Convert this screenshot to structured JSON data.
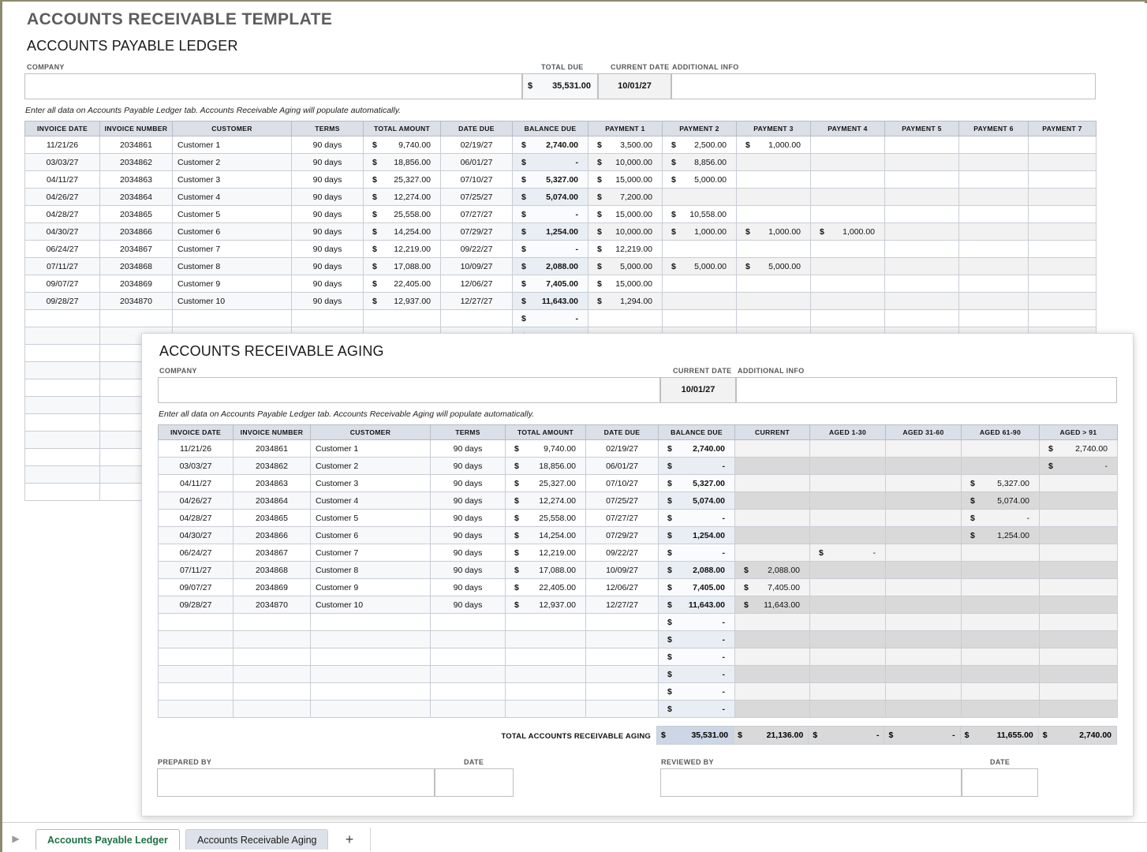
{
  "doc": {
    "title": "ACCOUNTS RECEIVABLE TEMPLATE",
    "section_title": "ACCOUNTS PAYABLE LEDGER",
    "note": "Enter all data on Accounts Payable Ledger tab.  Accounts Receivable Aging will populate automatically."
  },
  "ledger_header": {
    "company_label": "COMPANY",
    "company_value": "",
    "total_due_label": "TOTAL DUE",
    "total_due_symbol": "$",
    "total_due_value": "35,531.00",
    "current_date_label": "CURRENT DATE",
    "current_date_value": "10/01/27",
    "additional_info_label": "ADDITIONAL INFO",
    "additional_info_value": ""
  },
  "ledger_table": {
    "columns": [
      "INVOICE DATE",
      "INVOICE NUMBER",
      "CUSTOMER",
      "TERMS",
      "TOTAL AMOUNT",
      "DATE DUE",
      "BALANCE DUE",
      "PAYMENT 1",
      "PAYMENT 2",
      "PAYMENT 3",
      "PAYMENT 4",
      "PAYMENT 5",
      "PAYMENT 6",
      "PAYMENT 7"
    ],
    "currency_symbol": "$",
    "rows": [
      {
        "invoice_date": "11/21/26",
        "invoice_number": "2034861",
        "customer": "Customer 1",
        "terms": "90 days",
        "total_amount": "9,740.00",
        "date_due": "02/19/27",
        "balance_due": "2,740.00",
        "payments": [
          "3,500.00",
          "2,500.00",
          "1,000.00",
          "",
          "",
          "",
          ""
        ]
      },
      {
        "invoice_date": "03/03/27",
        "invoice_number": "2034862",
        "customer": "Customer 2",
        "terms": "90 days",
        "total_amount": "18,856.00",
        "date_due": "06/01/27",
        "balance_due": "-",
        "payments": [
          "10,000.00",
          "8,856.00",
          "",
          "",
          "",
          "",
          ""
        ]
      },
      {
        "invoice_date": "04/11/27",
        "invoice_number": "2034863",
        "customer": "Customer 3",
        "terms": "90 days",
        "total_amount": "25,327.00",
        "date_due": "07/10/27",
        "balance_due": "5,327.00",
        "payments": [
          "15,000.00",
          "5,000.00",
          "",
          "",
          "",
          "",
          ""
        ]
      },
      {
        "invoice_date": "04/26/27",
        "invoice_number": "2034864",
        "customer": "Customer 4",
        "terms": "90 days",
        "total_amount": "12,274.00",
        "date_due": "07/25/27",
        "balance_due": "5,074.00",
        "payments": [
          "7,200.00",
          "",
          "",
          "",
          "",
          "",
          ""
        ]
      },
      {
        "invoice_date": "04/28/27",
        "invoice_number": "2034865",
        "customer": "Customer 5",
        "terms": "90 days",
        "total_amount": "25,558.00",
        "date_due": "07/27/27",
        "balance_due": "-",
        "payments": [
          "15,000.00",
          "10,558.00",
          "",
          "",
          "",
          "",
          ""
        ]
      },
      {
        "invoice_date": "04/30/27",
        "invoice_number": "2034866",
        "customer": "Customer 6",
        "terms": "90 days",
        "total_amount": "14,254.00",
        "date_due": "07/29/27",
        "balance_due": "1,254.00",
        "payments": [
          "10,000.00",
          "1,000.00",
          "1,000.00",
          "1,000.00",
          "",
          "",
          ""
        ]
      },
      {
        "invoice_date": "06/24/27",
        "invoice_number": "2034867",
        "customer": "Customer 7",
        "terms": "90 days",
        "total_amount": "12,219.00",
        "date_due": "09/22/27",
        "balance_due": "-",
        "payments": [
          "12,219.00",
          "",
          "",
          "",
          "",
          "",
          ""
        ]
      },
      {
        "invoice_date": "07/11/27",
        "invoice_number": "2034868",
        "customer": "Customer 8",
        "terms": "90 days",
        "total_amount": "17,088.00",
        "date_due": "10/09/27",
        "balance_due": "2,088.00",
        "payments": [
          "5,000.00",
          "5,000.00",
          "5,000.00",
          "",
          "",
          "",
          ""
        ]
      },
      {
        "invoice_date": "09/07/27",
        "invoice_number": "2034869",
        "customer": "Customer 9",
        "terms": "90 days",
        "total_amount": "22,405.00",
        "date_due": "12/06/27",
        "balance_due": "7,405.00",
        "payments": [
          "15,000.00",
          "",
          "",
          "",
          "",
          "",
          ""
        ]
      },
      {
        "invoice_date": "09/28/27",
        "invoice_number": "2034870",
        "customer": "Customer 10",
        "terms": "90 days",
        "total_amount": "12,937.00",
        "date_due": "12/27/27",
        "balance_due": "11,643.00",
        "payments": [
          "1,294.00",
          "",
          "",
          "",
          "",
          "",
          ""
        ]
      },
      {
        "invoice_date": "",
        "invoice_number": "",
        "customer": "",
        "terms": "",
        "total_amount": "",
        "date_due": "",
        "balance_due": "-",
        "payments": [
          "",
          "",
          "",
          "",
          "",
          "",
          ""
        ]
      },
      {
        "invoice_date": "",
        "invoice_number": "",
        "customer": "",
        "terms": "",
        "total_amount": "",
        "date_due": "",
        "balance_due": "-",
        "payments": [
          "",
          "",
          "",
          "",
          "",
          "",
          ""
        ]
      },
      {
        "invoice_date": "",
        "invoice_number": "",
        "customer": "",
        "terms": "",
        "total_amount": "",
        "date_due": "",
        "balance_due": "",
        "payments": [
          "",
          "",
          "",
          "",
          "",
          "",
          ""
        ]
      },
      {
        "invoice_date": "",
        "invoice_number": "",
        "customer": "",
        "terms": "",
        "total_amount": "",
        "date_due": "",
        "balance_due": "",
        "payments": [
          "",
          "",
          "",
          "",
          "",
          "",
          ""
        ]
      },
      {
        "invoice_date": "",
        "invoice_number": "",
        "customer": "",
        "terms": "",
        "total_amount": "",
        "date_due": "",
        "balance_due": "",
        "payments": [
          "",
          "",
          "",
          "",
          "",
          "",
          ""
        ]
      },
      {
        "invoice_date": "",
        "invoice_number": "",
        "customer": "",
        "terms": "",
        "total_amount": "",
        "date_due": "",
        "balance_due": "",
        "payments": [
          "",
          "",
          "",
          "",
          "",
          "",
          ""
        ]
      },
      {
        "invoice_date": "",
        "invoice_number": "",
        "customer": "",
        "terms": "",
        "total_amount": "",
        "date_due": "",
        "balance_due": "",
        "payments": [
          "",
          "",
          "",
          "",
          "",
          "",
          ""
        ]
      },
      {
        "invoice_date": "",
        "invoice_number": "",
        "customer": "",
        "terms": "",
        "total_amount": "",
        "date_due": "",
        "balance_due": "",
        "payments": [
          "",
          "",
          "",
          "",
          "",
          "",
          ""
        ]
      },
      {
        "invoice_date": "",
        "invoice_number": "",
        "customer": "",
        "terms": "",
        "total_amount": "",
        "date_due": "",
        "balance_due": "",
        "payments": [
          "",
          "",
          "",
          "",
          "",
          "",
          ""
        ]
      },
      {
        "invoice_date": "",
        "invoice_number": "",
        "customer": "",
        "terms": "",
        "total_amount": "",
        "date_due": "",
        "balance_due": "",
        "payments": [
          "",
          "",
          "",
          "",
          "",
          "",
          ""
        ]
      },
      {
        "invoice_date": "",
        "invoice_number": "",
        "customer": "",
        "terms": "",
        "total_amount": "",
        "date_due": "",
        "balance_due": "",
        "payments": [
          "",
          "",
          "",
          "",
          "",
          "",
          ""
        ]
      }
    ]
  },
  "ar_panel": {
    "title": "ACCOUNTS RECEIVABLE AGING",
    "note": "Enter all data on Accounts Payable Ledger tab.  Accounts Receivable Aging will populate automatically.",
    "company_label": "COMPANY",
    "company_value": "",
    "current_date_label": "CURRENT DATE",
    "current_date_value": "10/01/27",
    "additional_info_label": "ADDITIONAL INFO",
    "additional_info_value": "",
    "columns": [
      "INVOICE DATE",
      "INVOICE NUMBER",
      "CUSTOMER",
      "TERMS",
      "TOTAL AMOUNT",
      "DATE DUE",
      "BALANCE DUE",
      "CURRENT",
      "AGED 1-30",
      "AGED 31-60",
      "AGED 61-90",
      "AGED > 91"
    ],
    "currency_symbol": "$",
    "rows": [
      {
        "invoice_date": "11/21/26",
        "invoice_number": "2034861",
        "customer": "Customer 1",
        "terms": "90 days",
        "total_amount": "9,740.00",
        "date_due": "02/19/27",
        "balance_due": "2,740.00",
        "current": "",
        "aged_1_30": "",
        "aged_31_60": "",
        "aged_61_90": "",
        "aged_91": "2,740.00"
      },
      {
        "invoice_date": "03/03/27",
        "invoice_number": "2034862",
        "customer": "Customer 2",
        "terms": "90 days",
        "total_amount": "18,856.00",
        "date_due": "06/01/27",
        "balance_due": "-",
        "current": "",
        "aged_1_30": "",
        "aged_31_60": "",
        "aged_61_90": "",
        "aged_91": "-"
      },
      {
        "invoice_date": "04/11/27",
        "invoice_number": "2034863",
        "customer": "Customer 3",
        "terms": "90 days",
        "total_amount": "25,327.00",
        "date_due": "07/10/27",
        "balance_due": "5,327.00",
        "current": "",
        "aged_1_30": "",
        "aged_31_60": "",
        "aged_61_90": "5,327.00",
        "aged_91": ""
      },
      {
        "invoice_date": "04/26/27",
        "invoice_number": "2034864",
        "customer": "Customer 4",
        "terms": "90 days",
        "total_amount": "12,274.00",
        "date_due": "07/25/27",
        "balance_due": "5,074.00",
        "current": "",
        "aged_1_30": "",
        "aged_31_60": "",
        "aged_61_90": "5,074.00",
        "aged_91": ""
      },
      {
        "invoice_date": "04/28/27",
        "invoice_number": "2034865",
        "customer": "Customer 5",
        "terms": "90 days",
        "total_amount": "25,558.00",
        "date_due": "07/27/27",
        "balance_due": "-",
        "current": "",
        "aged_1_30": "",
        "aged_31_60": "",
        "aged_61_90": "-",
        "aged_91": ""
      },
      {
        "invoice_date": "04/30/27",
        "invoice_number": "2034866",
        "customer": "Customer 6",
        "terms": "90 days",
        "total_amount": "14,254.00",
        "date_due": "07/29/27",
        "balance_due": "1,254.00",
        "current": "",
        "aged_1_30": "",
        "aged_31_60": "",
        "aged_61_90": "1,254.00",
        "aged_91": ""
      },
      {
        "invoice_date": "06/24/27",
        "invoice_number": "2034867",
        "customer": "Customer 7",
        "terms": "90 days",
        "total_amount": "12,219.00",
        "date_due": "09/22/27",
        "balance_due": "-",
        "current": "",
        "aged_1_30": "-",
        "aged_31_60": "",
        "aged_61_90": "",
        "aged_91": ""
      },
      {
        "invoice_date": "07/11/27",
        "invoice_number": "2034868",
        "customer": "Customer 8",
        "terms": "90 days",
        "total_amount": "17,088.00",
        "date_due": "10/09/27",
        "balance_due": "2,088.00",
        "current": "2,088.00",
        "aged_1_30": "",
        "aged_31_60": "",
        "aged_61_90": "",
        "aged_91": ""
      },
      {
        "invoice_date": "09/07/27",
        "invoice_number": "2034869",
        "customer": "Customer 9",
        "terms": "90 days",
        "total_amount": "22,405.00",
        "date_due": "12/06/27",
        "balance_due": "7,405.00",
        "current": "7,405.00",
        "aged_1_30": "",
        "aged_31_60": "",
        "aged_61_90": "",
        "aged_91": ""
      },
      {
        "invoice_date": "09/28/27",
        "invoice_number": "2034870",
        "customer": "Customer 10",
        "terms": "90 days",
        "total_amount": "12,937.00",
        "date_due": "12/27/27",
        "balance_due": "11,643.00",
        "current": "11,643.00",
        "aged_1_30": "",
        "aged_31_60": "",
        "aged_61_90": "",
        "aged_91": ""
      },
      {
        "invoice_date": "",
        "invoice_number": "",
        "customer": "",
        "terms": "",
        "total_amount": "",
        "date_due": "",
        "balance_due": "-",
        "current": "",
        "aged_1_30": "",
        "aged_31_60": "",
        "aged_61_90": "",
        "aged_91": ""
      },
      {
        "invoice_date": "",
        "invoice_number": "",
        "customer": "",
        "terms": "",
        "total_amount": "",
        "date_due": "",
        "balance_due": "-",
        "current": "",
        "aged_1_30": "",
        "aged_31_60": "",
        "aged_61_90": "",
        "aged_91": ""
      },
      {
        "invoice_date": "",
        "invoice_number": "",
        "customer": "",
        "terms": "",
        "total_amount": "",
        "date_due": "",
        "balance_due": "-",
        "current": "",
        "aged_1_30": "",
        "aged_31_60": "",
        "aged_61_90": "",
        "aged_91": ""
      },
      {
        "invoice_date": "",
        "invoice_number": "",
        "customer": "",
        "terms": "",
        "total_amount": "",
        "date_due": "",
        "balance_due": "-",
        "current": "",
        "aged_1_30": "",
        "aged_31_60": "",
        "aged_61_90": "",
        "aged_91": ""
      },
      {
        "invoice_date": "",
        "invoice_number": "",
        "customer": "",
        "terms": "",
        "total_amount": "",
        "date_due": "",
        "balance_due": "-",
        "current": "",
        "aged_1_30": "",
        "aged_31_60": "",
        "aged_61_90": "",
        "aged_91": ""
      },
      {
        "invoice_date": "",
        "invoice_number": "",
        "customer": "",
        "terms": "",
        "total_amount": "",
        "date_due": "",
        "balance_due": "-",
        "current": "",
        "aged_1_30": "",
        "aged_31_60": "",
        "aged_61_90": "",
        "aged_91": ""
      }
    ],
    "total_label": "TOTAL ACCOUNTS RECEIVABLE AGING",
    "totals": {
      "balance_due": "35,531.00",
      "current": "21,136.00",
      "aged_1_30": "-",
      "aged_31_60": "-",
      "aged_61_90": "11,655.00",
      "aged_91": "2,740.00"
    },
    "prepared_by_label": "PREPARED BY",
    "prepared_by_value": "",
    "prepared_date_label": "DATE",
    "prepared_date_value": "",
    "reviewed_by_label": "REVIEWED BY",
    "reviewed_by_value": "",
    "reviewed_date_label": "DATE",
    "reviewed_date_value": ""
  },
  "tabbar": {
    "scroll_arrow": "▶",
    "active_tab": "Accounts Payable Ledger",
    "inactive_tab": "Accounts Receivable Aging",
    "add_sheet": "+"
  },
  "colors": {
    "header_fill": "#dbe0e8",
    "balance_tint": "#eef1f6",
    "aged_tint": "#d9d9d9",
    "total_tint": "#ccd6e4",
    "active_tab_text": "#1d7044",
    "frame": "#8d8b6e"
  }
}
